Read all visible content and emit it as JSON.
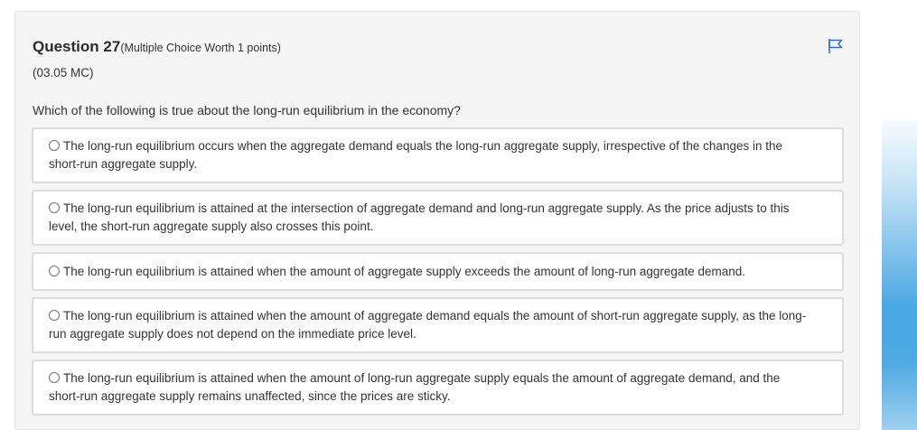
{
  "question": {
    "title": "Question 27",
    "meta": "(Multiple Choice Worth 1 points)",
    "code": "(03.05 MC)",
    "text": "Which of the following is true about the long-run equilibrium in the economy?",
    "flag_icon": "flag-icon"
  },
  "options": [
    {
      "text": "The long-run equilibrium occurs when the aggregate demand equals the long-run aggregate supply, irrespective of the changes in the short-run aggregate supply.",
      "selected": false
    },
    {
      "text": "The long-run equilibrium is attained at the intersection of aggregate demand and long-run aggregate supply. As the price adjusts to this level, the short-run aggregate supply also crosses this point.",
      "selected": false
    },
    {
      "text": "The long-run equilibrium is attained when the amount of aggregate supply exceeds the amount of long-run aggregate demand.",
      "selected": false
    },
    {
      "text": "The long-run equilibrium is attained when the amount of aggregate demand equals the amount of short-run aggregate supply, as the long-run aggregate supply does not depend on the immediate price level.",
      "selected": false
    },
    {
      "text": "The long-run equilibrium is attained when the amount of long-run aggregate supply equals the amount of aggregate demand, and the short-run aggregate supply remains unaffected, since the prices are sticky.",
      "selected": false
    }
  ],
  "colors": {
    "card_background": "#f5f5f5",
    "option_border": "#dcdcdc",
    "flag_blue": "#2f6fd6",
    "text": "#333333"
  }
}
